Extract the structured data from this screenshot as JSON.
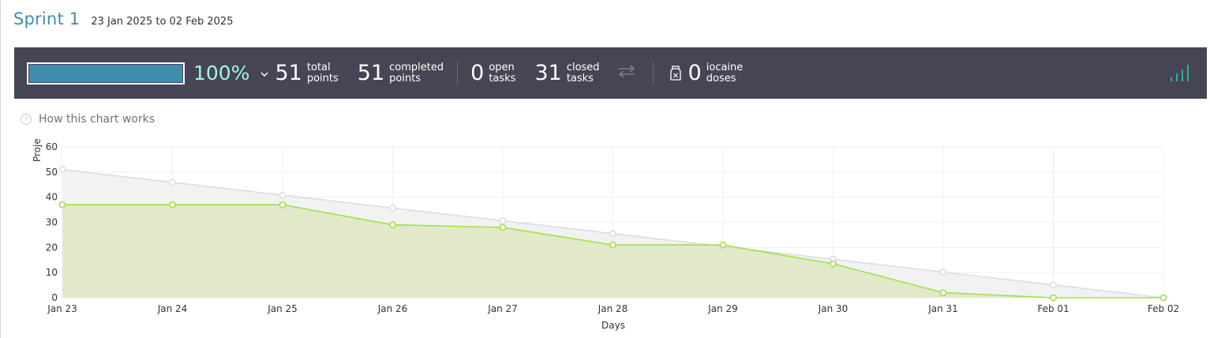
{
  "header": {
    "title": "Sprint 1",
    "dates": "23 Jan 2025 to 02 Feb 2025"
  },
  "stats": {
    "progress_percent": 100,
    "progress_label": "100%",
    "total_points": {
      "value": "51",
      "line1": "total",
      "line2": "points"
    },
    "completed_points": {
      "value": "51",
      "line1": "completed",
      "line2": "points"
    },
    "open_tasks": {
      "value": "0",
      "line1": "open",
      "line2": "tasks"
    },
    "closed_tasks": {
      "value": "31",
      "line1": "closed",
      "line2": "tasks"
    },
    "iocaine_doses": {
      "value": "0",
      "line1": "iocaine",
      "line2": "doses"
    },
    "colors": {
      "bar_bg": "#464555",
      "progress": "#3f8dad",
      "percent": "#9ff6ea",
      "graph_icon": "#26b4a0"
    },
    "icons": {
      "toggle": "chevron-down-icon",
      "swap": "swap-arrows-icon",
      "iocaine": "iocaine-jar-icon",
      "graph": "bar-graph-icon"
    }
  },
  "help": {
    "label": "How this chart works",
    "icon": "question-circle-icon"
  },
  "chart_data": {
    "type": "area",
    "xlabel": "Days",
    "ylabel": "Proje",
    "categories": [
      "Jan 23",
      "Jan 24",
      "Jan 25",
      "Jan 26",
      "Jan 27",
      "Jan 28",
      "Jan 29",
      "Jan 30",
      "Jan 31",
      "Feb 01",
      "Feb 02"
    ],
    "ylim": [
      0,
      60
    ],
    "yticks": [
      0,
      10,
      20,
      30,
      40,
      50,
      60
    ],
    "grid": true,
    "series": [
      {
        "values": [
          51,
          45.9,
          40.8,
          35.7,
          30.6,
          25.5,
          20.4,
          15.3,
          10.2,
          5.1,
          0
        ],
        "line_color": "#dcdce8",
        "fill_color": "#f2f2f2"
      },
      {
        "values": [
          37,
          37,
          37,
          29,
          28,
          21,
          21,
          13.5,
          2,
          0,
          0
        ],
        "line_color": "#a3e048",
        "fill_color": "#dfe8c4"
      }
    ]
  }
}
